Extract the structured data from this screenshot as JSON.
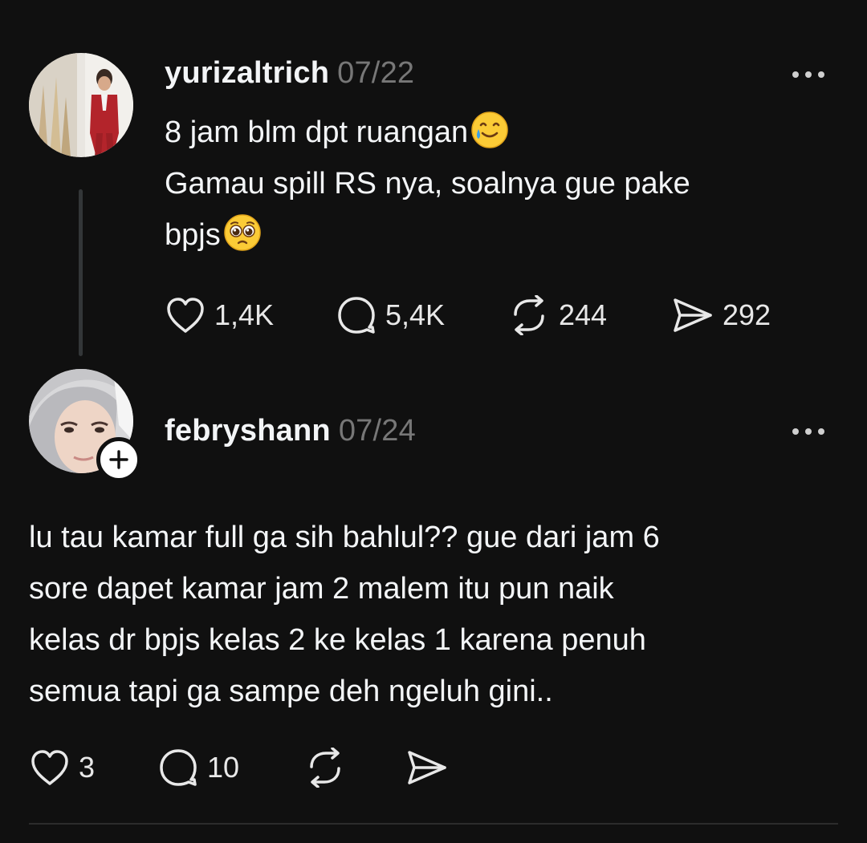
{
  "post1": {
    "username": "yurizaltrich",
    "date": "07/22",
    "avatar_icon": "profile-photo-man-red-suit",
    "text_line1": "8 jam blm dpt ruangan",
    "text_line1_emoji": "smiling-face-with-tear",
    "text_line2": "Gamau spill RS nya, soalnya gue pake",
    "text_line3": "bpjs",
    "text_line3_emoji": "pleading-face",
    "likes": "1,4K",
    "replies": "5,4K",
    "reposts": "244",
    "shares": "292"
  },
  "post2": {
    "username": "febryshann",
    "date": "07/24",
    "avatar_icon": "profile-photo-woman-hijab",
    "text_lines": [
      "lu tau kamar full ga sih bahlul?? gue dari jam 6",
      "sore dapet kamar jam 2 malem itu pun naik",
      "kelas dr bpjs kelas 2 ke kelas 1 karena penuh",
      "semua tapi ga sampe deh ngeluh gini.."
    ],
    "likes": "3",
    "replies": "10",
    "reposts": "",
    "shares": ""
  },
  "icons": {
    "like": "heart-icon",
    "reply": "comment-bubble-icon",
    "repost": "repost-arrows-icon",
    "share": "send-paper-plane-icon",
    "more": "more-dots-icon",
    "follow": "plus-icon"
  },
  "colors": {
    "background": "#101010",
    "text_primary": "#f3f5f7",
    "text_secondary": "#777777",
    "thread_line": "#333638"
  }
}
